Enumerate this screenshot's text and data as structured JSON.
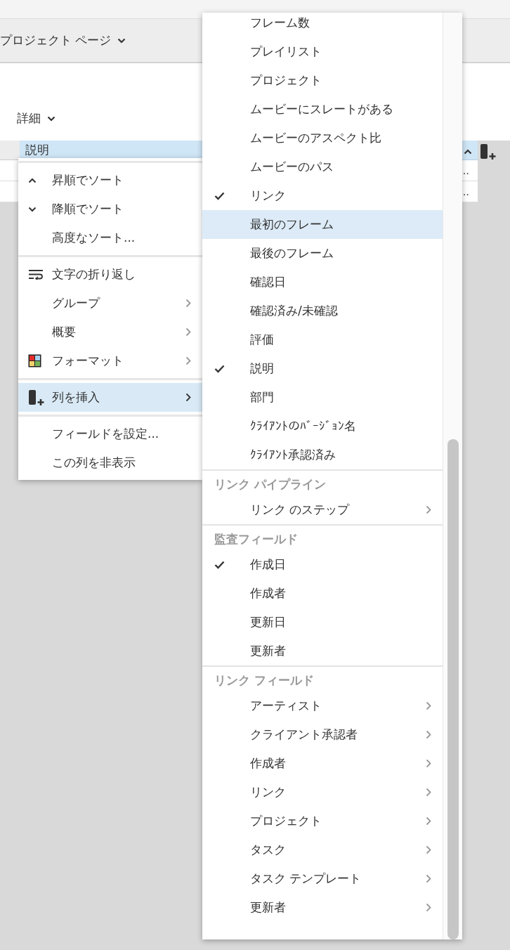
{
  "toolbar": {
    "page_menu": "プロジェクト ページ"
  },
  "view_menu": {
    "label": "詳細"
  },
  "table": {
    "column": {
      "label": "説明",
      "selected": true,
      "sorted_ascending": true
    },
    "rows": [
      {
        "cell": "…"
      },
      {
        "cell": "…"
      }
    ]
  },
  "context_menu": {
    "groups": [
      [
        {
          "kind": "sort-asc",
          "label": "昇順でソート",
          "submenu": false,
          "selected": false
        },
        {
          "kind": "sort-desc",
          "label": "降順でソート",
          "submenu": false,
          "selected": false
        },
        {
          "kind": "plain",
          "label": "高度なソート...",
          "submenu": false,
          "selected": false
        }
      ],
      [
        {
          "kind": "wrap",
          "label": "文字の折り返し",
          "submenu": false,
          "selected": false
        },
        {
          "kind": "plain",
          "label": "グループ",
          "submenu": true,
          "selected": false
        },
        {
          "kind": "plain",
          "label": "概要",
          "submenu": true,
          "selected": false
        },
        {
          "kind": "format",
          "label": "フォーマット",
          "submenu": true,
          "selected": false
        }
      ],
      [
        {
          "kind": "insert-column",
          "label": "列を挿入",
          "submenu": true,
          "selected": true
        }
      ],
      [
        {
          "kind": "plain",
          "label": "フィールドを設定...",
          "submenu": false,
          "selected": false
        },
        {
          "kind": "plain",
          "label": "この列を非表示",
          "submenu": false,
          "selected": false
        }
      ]
    ]
  },
  "submenu": {
    "sections": [
      {
        "items": [
          {
            "label": "フレーム数",
            "checked": false,
            "submenu": false,
            "selected": false
          },
          {
            "label": "プレイリスト",
            "checked": false,
            "submenu": false,
            "selected": false
          },
          {
            "label": "プロジェクト",
            "checked": false,
            "submenu": false,
            "selected": false
          },
          {
            "label": "ムービーにスレートがある",
            "checked": false,
            "submenu": false,
            "selected": false
          },
          {
            "label": "ムービーのアスペクト比",
            "checked": false,
            "submenu": false,
            "selected": false
          },
          {
            "label": "ムービーのパス",
            "checked": false,
            "submenu": false,
            "selected": false
          },
          {
            "label": "リンク",
            "checked": true,
            "submenu": false,
            "selected": false
          },
          {
            "label": "最初のフレーム",
            "checked": false,
            "submenu": false,
            "selected": true
          },
          {
            "label": "最後のフレーム",
            "checked": false,
            "submenu": false,
            "selected": false
          },
          {
            "label": "確認日",
            "checked": false,
            "submenu": false,
            "selected": false
          },
          {
            "label": "確認済み/未確認",
            "checked": false,
            "submenu": false,
            "selected": false
          },
          {
            "label": "評価",
            "checked": false,
            "submenu": false,
            "selected": false
          },
          {
            "label": "説明",
            "checked": true,
            "submenu": false,
            "selected": false
          },
          {
            "label": "部門",
            "checked": false,
            "submenu": false,
            "selected": false
          },
          {
            "label": "ｸﾗｲｱﾝﾄのﾊﾞｰｼﾞｮﾝ名",
            "checked": false,
            "submenu": false,
            "selected": false
          },
          {
            "label": "ｸﾗｲｱﾝﾄ承認済み",
            "checked": false,
            "submenu": false,
            "selected": false
          }
        ]
      },
      {
        "title": "リンク パイプライン",
        "items": [
          {
            "label": "リンク のステップ",
            "checked": false,
            "submenu": true,
            "selected": false
          }
        ]
      },
      {
        "title": "監査フィールド",
        "items": [
          {
            "label": "作成日",
            "checked": true,
            "submenu": false,
            "selected": false
          },
          {
            "label": "作成者",
            "checked": false,
            "submenu": false,
            "selected": false
          },
          {
            "label": "更新日",
            "checked": false,
            "submenu": false,
            "selected": false
          },
          {
            "label": "更新者",
            "checked": false,
            "submenu": false,
            "selected": false
          }
        ]
      },
      {
        "title": "リンク フィールド",
        "items": [
          {
            "label": "アーティスト",
            "checked": false,
            "submenu": true,
            "selected": false
          },
          {
            "label": "クライアント承認者",
            "checked": false,
            "submenu": true,
            "selected": false
          },
          {
            "label": "作成者",
            "checked": false,
            "submenu": true,
            "selected": false
          },
          {
            "label": "リンク",
            "checked": false,
            "submenu": true,
            "selected": false
          },
          {
            "label": "プロジェクト",
            "checked": false,
            "submenu": true,
            "selected": false
          },
          {
            "label": "タスク",
            "checked": false,
            "submenu": true,
            "selected": false
          },
          {
            "label": "タスク テンプレート",
            "checked": false,
            "submenu": true,
            "selected": false
          },
          {
            "label": "更新者",
            "checked": false,
            "submenu": true,
            "selected": false
          }
        ]
      }
    ]
  }
}
